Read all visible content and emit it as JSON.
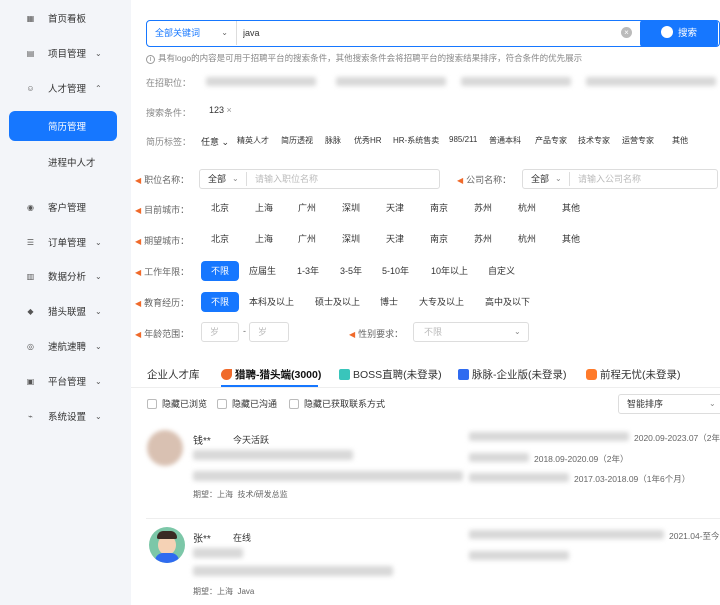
{
  "sidebar": {
    "items": [
      {
        "label": "首页看板",
        "icon": "home-icon",
        "glyph": "▦"
      },
      {
        "label": "项目管理",
        "icon": "project-icon",
        "glyph": "▤",
        "chevron": "⌄"
      },
      {
        "label": "人才管理",
        "icon": "talent-icon",
        "glyph": "☺",
        "chevron": "⌃"
      },
      {
        "label": "简历管理",
        "active": true
      },
      {
        "label": "进程中人才"
      },
      {
        "label": "客户管理",
        "icon": "customer-icon",
        "glyph": "◉"
      },
      {
        "label": "订单管理",
        "icon": "order-icon",
        "glyph": "☰",
        "chevron": "⌄"
      },
      {
        "label": "数据分析",
        "icon": "chart-icon",
        "glyph": "▥",
        "chevron": "⌄"
      },
      {
        "label": "猎头联盟",
        "icon": "alliance-icon",
        "glyph": "◆",
        "chevron": "⌄"
      },
      {
        "label": "速航速聘",
        "icon": "rocket-icon",
        "glyph": "◎",
        "chevron": "⌄"
      },
      {
        "label": "平台管理",
        "icon": "platform-icon",
        "glyph": "▣",
        "chevron": "⌄"
      },
      {
        "label": "系统设置",
        "icon": "settings-icon",
        "glyph": "⌁",
        "chevron": "⌄"
      }
    ]
  },
  "search": {
    "scope": "全部关键词",
    "value": "java",
    "button": "搜索",
    "hint": "具有logo的内容是可用于招聘平台的搜索条件，其他搜索条件会将招聘平台的搜索结果排序，符合条件的优先展示"
  },
  "filters": {
    "current_position_label": "在招职位：",
    "conditions_label": "搜索条件：",
    "condition_tag": "123",
    "resume_tags_label": "简历标签：",
    "resume_tags_any": "任意",
    "resume_tags": [
      "精英人才",
      "简历透视",
      "脉脉",
      "优秀HR",
      "HR-系统售卖",
      "985/211",
      "普通本科",
      "产品专家",
      "技术专家",
      "运营专家",
      "其他"
    ],
    "job_name_label": "职位名称：",
    "job_name_scope": "全部",
    "job_name_placeholder": "请输入职位名称",
    "company_label": "公司名称：",
    "company_scope": "全部",
    "company_placeholder": "请输入公司名称",
    "current_city_label": "目前城市：",
    "expected_city_label": "期望城市：",
    "cities": [
      "北京",
      "上海",
      "广州",
      "深圳",
      "天津",
      "南京",
      "苏州",
      "杭州",
      "其他"
    ],
    "work_years_label": "工作年限：",
    "work_years": [
      "不限",
      "应届生",
      "1-3年",
      "3-5年",
      "5-10年",
      "10年以上",
      "自定义"
    ],
    "education_label": "教育经历：",
    "education": [
      "不限",
      "本科及以上",
      "硕士及以上",
      "博士",
      "大专及以上",
      "高中及以下"
    ],
    "age_label": "年龄范围：",
    "age_from_placeholder": "岁",
    "age_sep": "-",
    "age_to_placeholder": "岁",
    "gender_label": "性别要求：",
    "gender_placeholder": "不限"
  },
  "tabs": [
    {
      "label": "企业人才库"
    },
    {
      "label": "猎聘-猎头端(3000)",
      "active": true
    },
    {
      "label": "BOSS直聘(未登录)"
    },
    {
      "label": "脉脉-企业版(未登录)"
    },
    {
      "label": "前程无忧(未登录)"
    }
  ],
  "options": {
    "hide_viewed": "隐藏已浏览",
    "hide_contacted": "隐藏已沟通",
    "hide_contact_obtained": "隐藏已获取联系方式",
    "sort": "智能排序"
  },
  "candidates": [
    {
      "name": "钱**",
      "status": "今天活跃",
      "expect_label": "期望：",
      "expect_city": "上海",
      "expect_role": "技术/研发总监",
      "experiences": [
        "2020.09-2023.07（2年",
        "2018.09-2020.09（2年）",
        "2017.03-2018.09（1年6个月）"
      ]
    },
    {
      "name": "张**",
      "status": "在线",
      "expect_label": "期望：",
      "expect_city": "上海",
      "expect_role": "Java",
      "experiences": [
        "2021.04-至今"
      ]
    }
  ],
  "colors": {
    "primary": "#1677ff",
    "accent_flame": "#f06a2a"
  }
}
